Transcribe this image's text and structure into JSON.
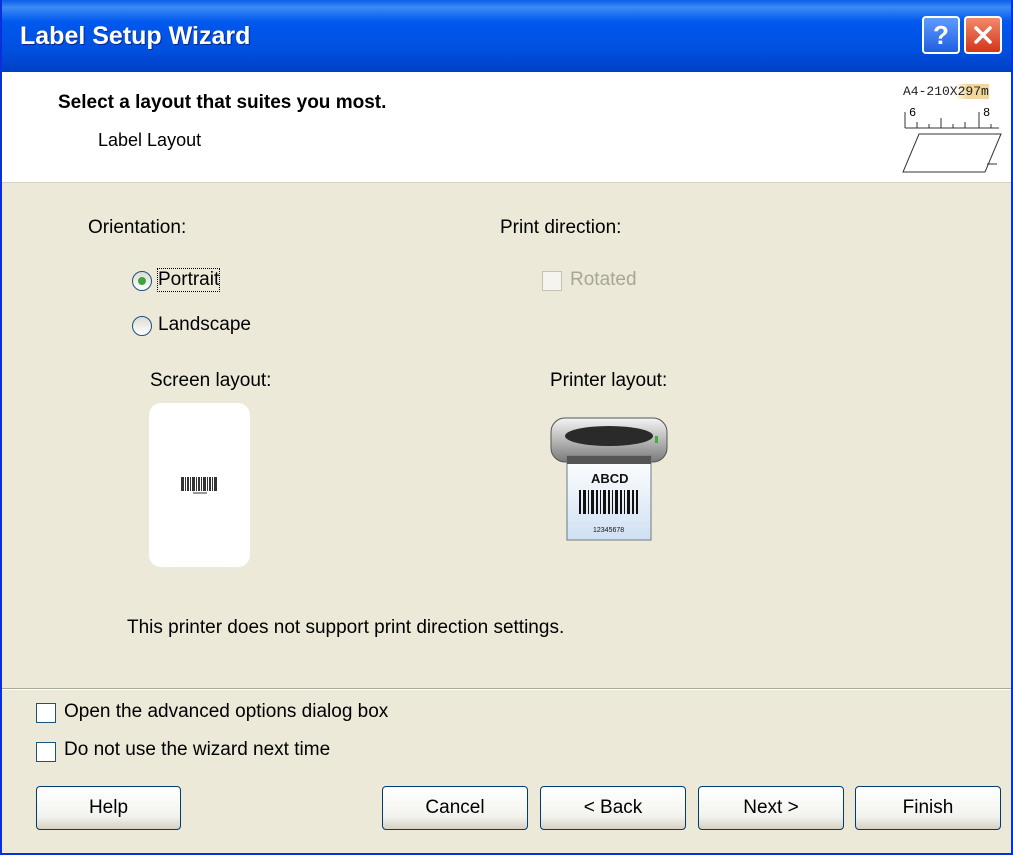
{
  "window": {
    "title": "Label Setup Wizard"
  },
  "header": {
    "title": "Select a layout that suites you most.",
    "subtitle": "Label Layout",
    "paper_size": "A4-210X297m",
    "ruler_marks": [
      "6",
      "8"
    ]
  },
  "orientation": {
    "label": "Orientation:",
    "options": [
      {
        "label": "Portrait",
        "selected": true
      },
      {
        "label": "Landscape",
        "selected": false
      }
    ]
  },
  "print_direction": {
    "label": "Print direction:",
    "rotated_label": "Rotated",
    "rotated_checked": false,
    "enabled": false
  },
  "screen_layout": {
    "label": "Screen layout:"
  },
  "printer_layout": {
    "label": "Printer layout:",
    "sample_text": "ABCD",
    "sample_barcode_number": "12345678"
  },
  "notice": "This printer does not support print direction settings.",
  "options": {
    "advanced_label": "Open the advanced options dialog box",
    "advanced_checked": false,
    "no_wizard_label": "Do not use the wizard next time",
    "no_wizard_checked": false
  },
  "buttons": {
    "help": "Help",
    "cancel": "Cancel",
    "back": "< Back",
    "next": "Next >",
    "finish": "Finish"
  },
  "colors": {
    "titlebar": "#0058ee",
    "dialog_bg": "#ece9d8",
    "radio_dot": "#3fa33f",
    "disabled_text": "#a7a697"
  }
}
